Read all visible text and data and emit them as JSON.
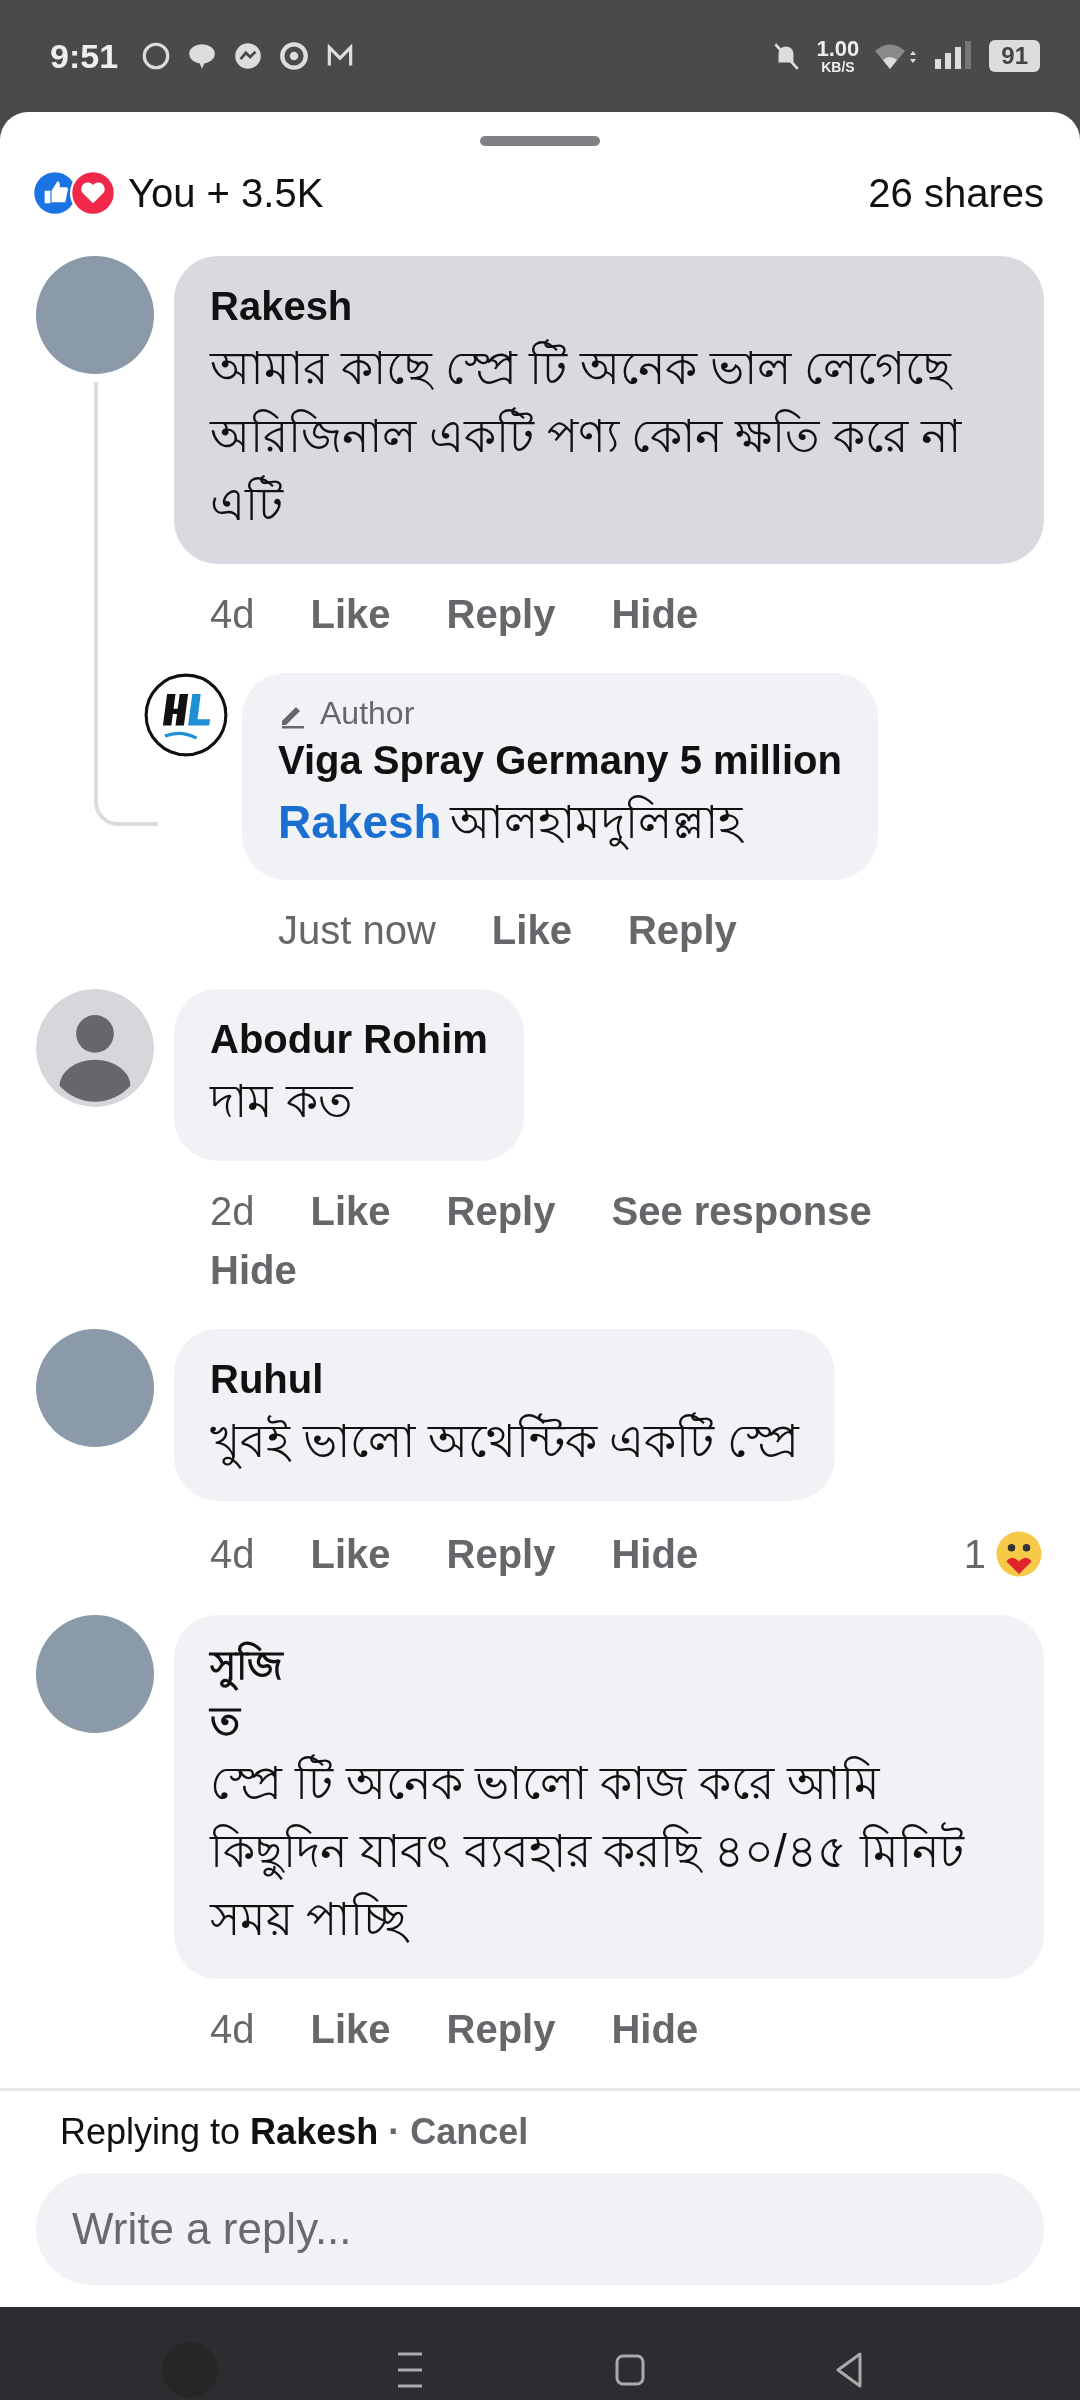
{
  "status_bar": {
    "time": "9:51",
    "speed": "1.00",
    "speed_unit": "KB/S",
    "battery": "91"
  },
  "summary": {
    "reactions_text": "You + 3.5K",
    "shares": "26 shares"
  },
  "comments": [
    {
      "kind": "photo",
      "name_lines": [
        "Rakesh"
      ],
      "text": "আমার কাছে স্প্রে টি অনেক ভাল লেগেছে অরিজিনাল একটি পণ্য কোন ক্ষতি করে না এটি",
      "highlighted": true,
      "time": "4d",
      "actions": [
        "Like",
        "Reply",
        "Hide"
      ],
      "replies": [
        {
          "kind": "logo",
          "author_badge": "Author",
          "name_lines": [
            "Viga Spray Germany 5 million"
          ],
          "mention": "Rakesh",
          "text": "আলহামদুলিল্লাহ",
          "highlighted": false,
          "time": "Just now",
          "actions": [
            "Like",
            "Reply"
          ]
        }
      ]
    },
    {
      "kind": "default",
      "name_lines": [
        "Abodur Rohim"
      ],
      "text": "দাম কত",
      "highlighted": false,
      "time": "2d",
      "actions": [
        "Like",
        "Reply",
        "See response",
        "Hide"
      ]
    },
    {
      "kind": "photo",
      "name_lines": [
        "Ruhul"
      ],
      "text": "খুবই ভালো অথেন্টিক একটি স্প্রে",
      "highlighted": false,
      "time": "4d",
      "actions": [
        "Like",
        "Reply",
        "Hide"
      ],
      "reaction": {
        "count": "1"
      }
    },
    {
      "kind": "photo",
      "name_lines": [
        "সুজি",
        "ত"
      ],
      "text": "স্প্রে টি অনেক ভালো কাজ করে আমি কিছুদিন যাবৎ ব্যবহার করছি ৪০/৪৫ মিনিট সময় পাচ্ছি",
      "highlighted": false,
      "time": "4d",
      "actions": [
        "Like",
        "Reply",
        "Hide"
      ]
    }
  ],
  "composer": {
    "replying_to": "Replying to",
    "name": "Rakesh",
    "separator": "·",
    "cancel": "Cancel",
    "placeholder": "Write a reply..."
  }
}
